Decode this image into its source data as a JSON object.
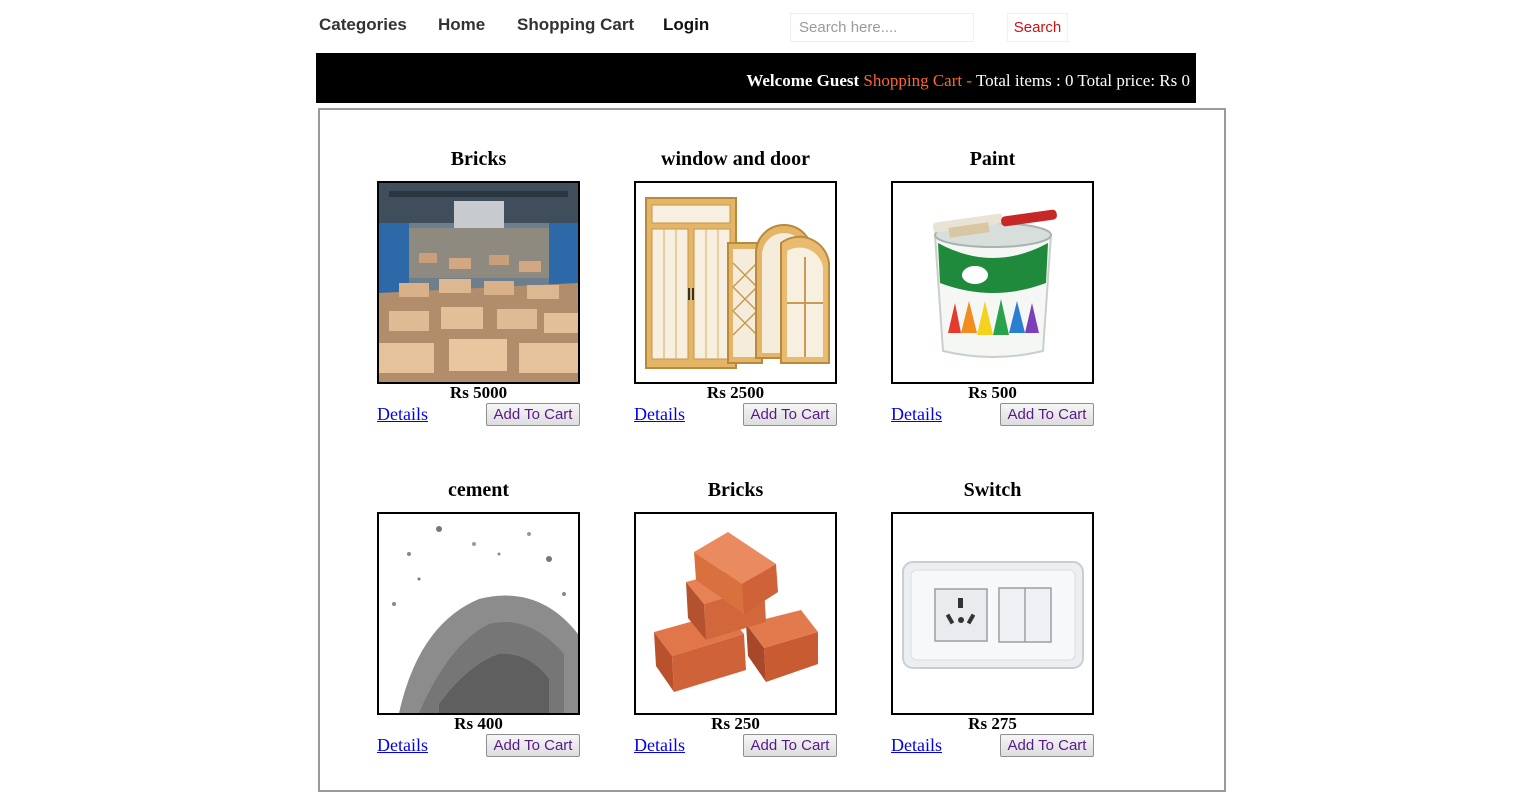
{
  "nav": {
    "categories": "Categories",
    "home": "Home",
    "shopping_cart": "Shopping Cart",
    "login": "Login",
    "search_placeholder": "Search here....",
    "search_button": "Search"
  },
  "cart_bar": {
    "welcome": "Welcome Guest",
    "cart_link": "Shopping Cart -",
    "summary": "Total items : 0 Total price: Rs 0"
  },
  "products": [
    {
      "title": "Bricks",
      "price": "Rs 5000",
      "details": "Details",
      "add": "Add To Cart",
      "image": "brick-factory-image"
    },
    {
      "title": "window and door",
      "price": "Rs 2500",
      "details": "Details",
      "add": "Add To Cart",
      "image": "window-door-image"
    },
    {
      "title": "Paint",
      "price": "Rs 500",
      "details": "Details",
      "add": "Add To Cart",
      "image": "paint-bucket-image"
    },
    {
      "title": "cement",
      "price": "Rs 400",
      "details": "Details",
      "add": "Add To Cart",
      "image": "cement-pile-image"
    },
    {
      "title": "Bricks",
      "price": "Rs 250",
      "details": "Details",
      "add": "Add To Cart",
      "image": "red-bricks-image"
    },
    {
      "title": "Switch",
      "price": "Rs 275",
      "details": "Details",
      "add": "Add To Cart",
      "image": "wall-switch-image"
    }
  ],
  "colors": {
    "cart_bar_bg": "#000000",
    "cart_link": "#ff6633",
    "search_button_text": "#cc1111",
    "details_link": "#0000ee"
  }
}
